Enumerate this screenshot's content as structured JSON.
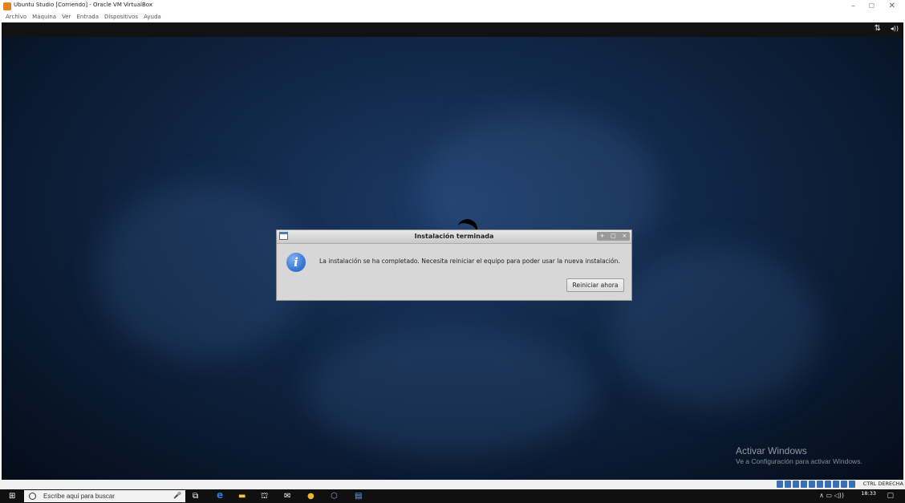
{
  "host_window": {
    "title": "Ubuntu Studio [Corriendo] - Oracle VM VirtualBox",
    "controls": {
      "minimize": "–",
      "maximize": "☐",
      "close": "✕"
    },
    "menu": [
      "Archivo",
      "Máquina",
      "Ver",
      "Entrada",
      "Dispositivos",
      "Ayuda"
    ]
  },
  "guest": {
    "tray": {
      "network_glyph": "⇅",
      "volume_glyph": "◂))"
    },
    "watermark": {
      "title": "Activar Windows",
      "subtitle": "Ve a Configuración para activar Windows."
    }
  },
  "dialog": {
    "title": "Instalación terminada",
    "controls": {
      "pin": "+",
      "maximize": "□",
      "close": "×"
    },
    "icon_glyph": "i",
    "message": "La instalación se ha completado. Necesita reiniciar el equipo para poder usar la nueva instalación.",
    "button_label": "Reiniciar ahora"
  },
  "statusbar": {
    "host_key": "CTRL DERECHA"
  },
  "taskbar": {
    "start_glyph": "⊞",
    "search_placeholder": "Escribe aquí para buscar",
    "mic_glyph": "🎤",
    "apps": [
      {
        "name": "task-view",
        "glyph": "⧉",
        "color": "#ffffff"
      },
      {
        "name": "edge",
        "glyph": "e",
        "color": "#2d7fd8"
      },
      {
        "name": "file-explorer",
        "glyph": "▬",
        "color": "#f2c744"
      },
      {
        "name": "store",
        "glyph": "⛫",
        "color": "#ffffff"
      },
      {
        "name": "mail",
        "glyph": "✉",
        "color": "#ffffff"
      },
      {
        "name": "chrome",
        "glyph": "●",
        "color": "#e9b929"
      },
      {
        "name": "virtualbox",
        "glyph": "⬡",
        "color": "#7aa3d8"
      },
      {
        "name": "document",
        "glyph": "▤",
        "color": "#6aa6e8"
      }
    ],
    "tray_glyphs": "∧ ▭ ◁))",
    "clock": "18:33",
    "notification_glyph": "▢"
  },
  "colors": {
    "dialog_bg": "#d7d7d7",
    "info_icon": "#3a7ad4",
    "taskbar": "#101010",
    "wallpaper": "#12294a"
  }
}
